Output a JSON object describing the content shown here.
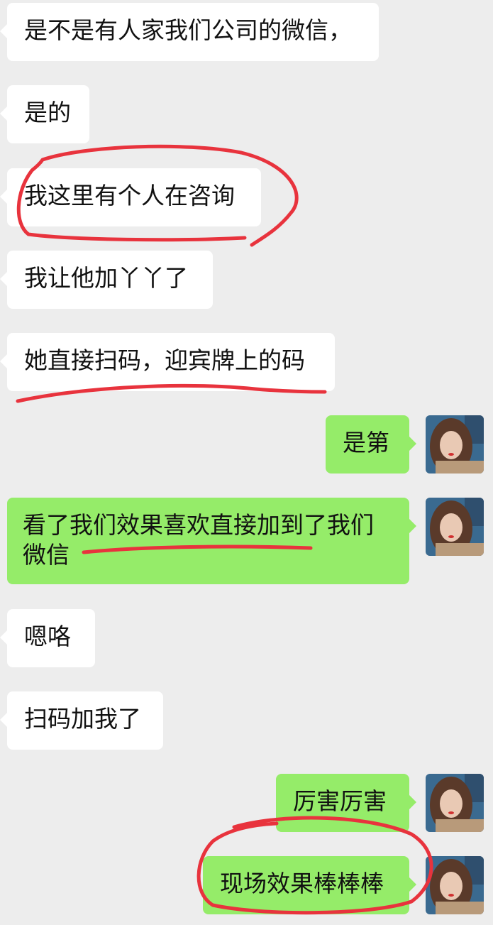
{
  "messages": [
    {
      "side": "in",
      "text": "是不是有人家我们公司的微信，"
    },
    {
      "side": "in",
      "text": "是的"
    },
    {
      "side": "in",
      "text": "我这里有个人在咨询"
    },
    {
      "side": "in",
      "text": "我让他加丫丫了"
    },
    {
      "side": "in",
      "text": "她直接扫码，迎宾牌上的码"
    },
    {
      "side": "out",
      "text": "是第"
    },
    {
      "side": "out",
      "text": "看了我们效果喜欢直接加到了我们微信"
    },
    {
      "side": "in",
      "text": "嗯咯"
    },
    {
      "side": "in",
      "text": "扫码加我了"
    },
    {
      "side": "out",
      "text": "厉害厉害"
    },
    {
      "side": "out",
      "text": "现场效果棒棒棒"
    }
  ],
  "colors": {
    "background": "#ededed",
    "incoming_bubble": "#ffffff",
    "outgoing_bubble": "#95ec69",
    "annotation": "#e8333d"
  },
  "avatar_icon": "user-photo-avatar"
}
